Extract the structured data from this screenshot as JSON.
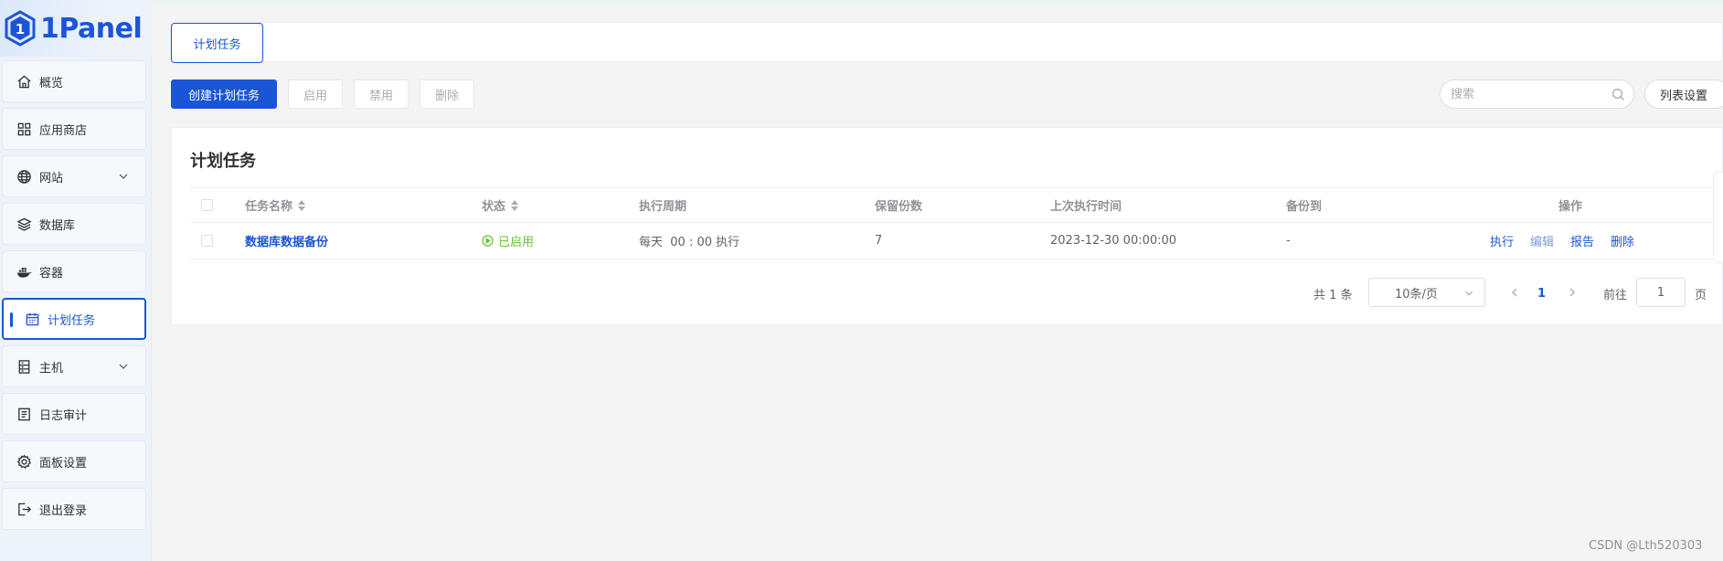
{
  "brand": {
    "logo_text": "1Panel"
  },
  "sidebar": {
    "items": [
      {
        "label": "概览",
        "icon": "home-icon"
      },
      {
        "label": "应用商店",
        "icon": "grid-icon"
      },
      {
        "label": "网站",
        "icon": "globe-icon",
        "expandable": true
      },
      {
        "label": "数据库",
        "icon": "layers-icon"
      },
      {
        "label": "容器",
        "icon": "docker-icon"
      },
      {
        "label": "计划任务",
        "icon": "calendar-icon",
        "active": true
      },
      {
        "label": "主机",
        "icon": "server-icon",
        "expandable": true
      },
      {
        "label": "日志审计",
        "icon": "log-icon"
      },
      {
        "label": "面板设置",
        "icon": "gear-icon"
      },
      {
        "label": "退出登录",
        "icon": "logout-icon"
      }
    ]
  },
  "tabs": {
    "active_label": "计划任务"
  },
  "toolbar": {
    "create_label": "创建计划任务",
    "enable_label": "启用",
    "disable_label": "禁用",
    "delete_label": "删除",
    "search_placeholder": "搜索",
    "list_settings_label": "列表设置"
  },
  "card": {
    "title": "计划任务"
  },
  "table": {
    "columns": [
      "任务名称",
      "状态",
      "执行周期",
      "保留份数",
      "上次执行时间",
      "备份到",
      "操作"
    ],
    "rows": [
      {
        "name": "数据库数据备份",
        "status": "已启用",
        "cycle": "每天  00 : 00 执行",
        "retain": "7",
        "last_run": "2023-12-30 00:00:00",
        "backup_to": "-",
        "actions": [
          "执行",
          "编辑",
          "报告",
          "删除"
        ]
      }
    ]
  },
  "pagination": {
    "total_text": "共 1 条",
    "page_size": "10条/页",
    "current_page": "1",
    "goto_label": "前往",
    "goto_value": "1",
    "page_suffix": "页"
  },
  "watermark": "CSDN @Lth520303",
  "colors": {
    "primary": "#1a55d8",
    "success": "#67c23a",
    "sidebar_bg": "#eef3fb"
  }
}
